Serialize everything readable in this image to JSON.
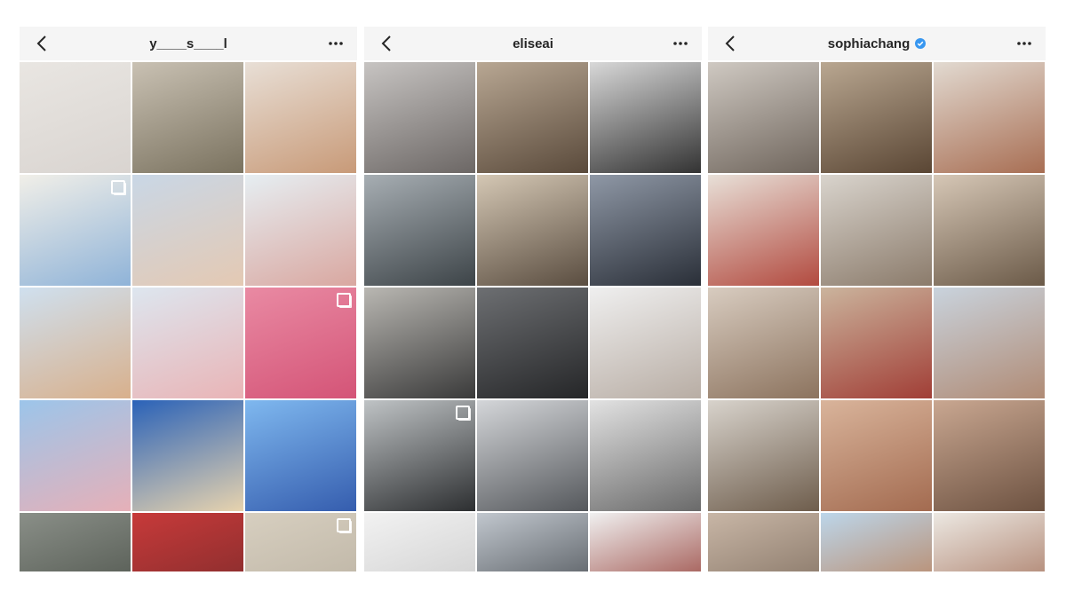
{
  "profiles": [
    {
      "username": "y____s____l",
      "verified": false,
      "back_icon": "chevron-left-icon",
      "more_icon": "more-horizontal-icon",
      "tiles": [
        {
          "colors": [
            "#e9e6e2",
            "#d9d4d0"
          ],
          "multi": false
        },
        {
          "colors": [
            "#c9c1b3",
            "#7a725f"
          ],
          "multi": false
        },
        {
          "colors": [
            "#e8dfd6",
            "#c89a78"
          ],
          "multi": false
        },
        {
          "colors": [
            "#f1efe8",
            "#8fb3d8"
          ],
          "multi": true
        },
        {
          "colors": [
            "#c9d7e6",
            "#e4c9b3"
          ],
          "multi": false
        },
        {
          "colors": [
            "#e6eef2",
            "#d9a7a0"
          ],
          "multi": false
        },
        {
          "colors": [
            "#cfe0ef",
            "#d8b08c"
          ],
          "multi": false
        },
        {
          "colors": [
            "#dde6ef",
            "#e9b4b6"
          ],
          "multi": false
        },
        {
          "colors": [
            "#e98aa3",
            "#d45477"
          ],
          "multi": true
        },
        {
          "colors": [
            "#9cc5ea",
            "#e6b0b8"
          ],
          "multi": false
        },
        {
          "colors": [
            "#2a62b8",
            "#e7d3ae"
          ],
          "multi": false
        },
        {
          "colors": [
            "#7fb8ef",
            "#355dae"
          ],
          "multi": false
        },
        {
          "colors": [
            "#8a8f88",
            "#4a5048"
          ],
          "multi": false
        },
        {
          "colors": [
            "#c73a3a",
            "#7a2a2a"
          ],
          "multi": false
        },
        {
          "colors": [
            "#d7cfc0",
            "#b9b0a0"
          ],
          "multi": true
        }
      ]
    },
    {
      "username": "eliseai",
      "verified": false,
      "back_icon": "chevron-left-icon",
      "more_icon": "more-horizontal-icon",
      "tiles": [
        {
          "colors": [
            "#c7c4c2",
            "#6c6765"
          ],
          "multi": false
        },
        {
          "colors": [
            "#b8a793",
            "#5a4a3b"
          ],
          "multi": false
        },
        {
          "colors": [
            "#d8d8d8",
            "#333333"
          ],
          "multi": false
        },
        {
          "colors": [
            "#a7aeb3",
            "#3d4448"
          ],
          "multi": false
        },
        {
          "colors": [
            "#d4c7b4",
            "#5a4d40"
          ],
          "multi": false
        },
        {
          "colors": [
            "#8f98a6",
            "#2a2f38"
          ],
          "multi": false
        },
        {
          "colors": [
            "#b9b7b2",
            "#3a3a3a"
          ],
          "multi": false
        },
        {
          "colors": [
            "#6d6f72",
            "#252628"
          ],
          "multi": false
        },
        {
          "colors": [
            "#efefef",
            "#b8ada4"
          ],
          "multi": false
        },
        {
          "colors": [
            "#bfc3c5",
            "#2d2f31"
          ],
          "multi": true
        },
        {
          "colors": [
            "#d4d6d9",
            "#55585c"
          ],
          "multi": false
        },
        {
          "colors": [
            "#e2e2e2",
            "#6a6a6a"
          ],
          "multi": false
        },
        {
          "colors": [
            "#f2f2f2",
            "#c9c9c9"
          ],
          "multi": false
        },
        {
          "colors": [
            "#c1c7ce",
            "#41464b"
          ],
          "multi": false
        },
        {
          "colors": [
            "#f0f0f0",
            "#8c2e26"
          ],
          "multi": false
        }
      ]
    },
    {
      "username": "sophiachang",
      "verified": true,
      "verified_icon": "verified-badge-icon",
      "back_icon": "chevron-left-icon",
      "more_icon": "more-horizontal-icon",
      "tiles": [
        {
          "colors": [
            "#cfc9c2",
            "#6f655c"
          ],
          "multi": false
        },
        {
          "colors": [
            "#b9a791",
            "#5a4634"
          ],
          "multi": false
        },
        {
          "colors": [
            "#e2dad1",
            "#a86e53"
          ],
          "multi": false
        },
        {
          "colors": [
            "#e8e0d8",
            "#b24a3f"
          ],
          "multi": false
        },
        {
          "colors": [
            "#d9d4cd",
            "#8b7b6b"
          ],
          "multi": false
        },
        {
          "colors": [
            "#d6c7b6",
            "#6b5a48"
          ],
          "multi": false
        },
        {
          "colors": [
            "#d8ccc0",
            "#8c735e"
          ],
          "multi": false
        },
        {
          "colors": [
            "#cbb49d",
            "#a13e36"
          ],
          "multi": false
        },
        {
          "colors": [
            "#c9d3dd",
            "#b08b75"
          ],
          "multi": false
        },
        {
          "colors": [
            "#d8d3cc",
            "#6e5d4c"
          ],
          "multi": false
        },
        {
          "colors": [
            "#d9b49b",
            "#a36b50"
          ],
          "multi": false
        },
        {
          "colors": [
            "#c9a791",
            "#6d5241"
          ],
          "multi": false
        },
        {
          "colors": [
            "#c8b6a6",
            "#7b6a5b"
          ],
          "multi": false
        },
        {
          "colors": [
            "#bcd6ea",
            "#b9784d"
          ],
          "multi": false
        },
        {
          "colors": [
            "#ece8e2",
            "#a06b54"
          ],
          "multi": false
        }
      ]
    }
  ]
}
